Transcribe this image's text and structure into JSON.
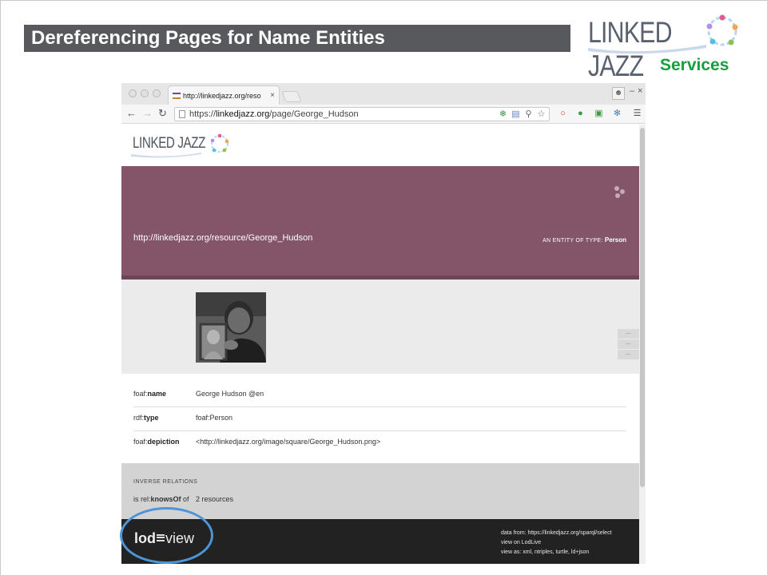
{
  "slide": {
    "title": "Dereferencing Pages for Name Entities",
    "logo_text": "LINKED JAZZ",
    "section_label": "Services"
  },
  "browser": {
    "tab_title": "http://linkedjazz.org/reso",
    "tab_close": "×",
    "url_scheme": "https://",
    "url_host": "linkedjazz.org",
    "url_path": "/page/George_Hudson"
  },
  "page": {
    "logo_text": "LINKED JAZZ",
    "resource_uri": "http://linkedjazz.org/resource/George_Hudson",
    "entity_type_label": "AN ENTITY OF TYPE:",
    "entity_type": "Person",
    "properties": [
      {
        "prefix": "foaf:",
        "name": "name",
        "value": "George Hudson @en"
      },
      {
        "prefix": "rdf:",
        "name": "type",
        "value": "foaf:Person"
      },
      {
        "prefix": "foaf:",
        "name": "depiction",
        "value": "<http://linkedjazz.org/image/square/George_Hudson.png>"
      }
    ],
    "inverse_title": "INVERSE RELATIONS",
    "inverse_prefix": "is rel:",
    "inverse_name": "knowsOf",
    "inverse_suffix": " of",
    "inverse_count": "2 resources"
  },
  "footer": {
    "logo_left": "lod",
    "logo_right": "view",
    "data_from": "data from: https://linkedjazz.org/sparql/select",
    "view_on": "view on LodLive",
    "view_as": "view as: xml, ntriples, turtle, ld+json"
  },
  "colors": {
    "title_bar": "#57595d",
    "services_green": "#15a03c",
    "hero_purple": "#845568",
    "highlight_blue": "#4b95d8"
  }
}
